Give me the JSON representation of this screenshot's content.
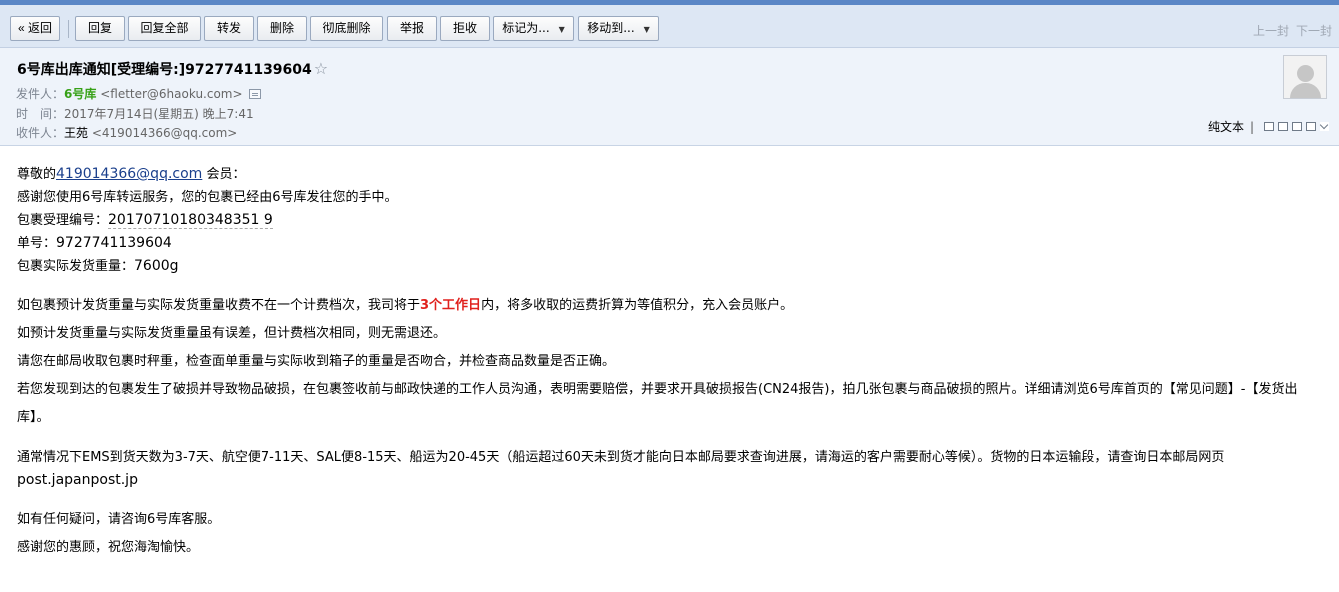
{
  "toolbar": {
    "back": "« 返回",
    "reply": "回复",
    "reply_all": "回复全部",
    "forward": "转发",
    "delete": "删除",
    "delete_forever": "彻底删除",
    "report": "举报",
    "reject": "拒收",
    "mark_as": "标记为...",
    "move_to": "移动到...",
    "prev": "上一封",
    "next": "下一封"
  },
  "header": {
    "subject": "6号库出库通知[受理编号:]9727741139604",
    "star": "☆",
    "from_label": "发件人：",
    "from_name": "6号库",
    "from_email": "<fletter@6haoku.com>",
    "time_label": "时　间：",
    "time_value": "2017年7月14日(星期五) 晚上7:41",
    "to_label": "收件人：",
    "to_name": "王苑",
    "to_email": "<419014366@qq.com>",
    "plain_text": "纯文本",
    "bar": "|"
  },
  "body": {
    "greet_prefix": "尊敬的",
    "greet_email": "419014366@qq.com",
    "greet_suffix": " 会员：",
    "line1": "感谢您使用6号库转运服务，您的包裹已经由6号库发往您的手中。",
    "accept_label": "包裹受理编号：",
    "accept_no": "20170710180348351 9",
    "order_label": "单号：",
    "order_no": "9727741139604",
    "weight_label": "包裹实际发货重量：",
    "weight_value": "7600g",
    "p1_a": "如包裹预计发货重量与实际发货重量收费不在一个计费档次，我司将于",
    "p1_hl": "3个工作日",
    "p1_b": "内，将多收取的运费折算为等值积分，充入会员账户。",
    "p2": "如预计发货重量与实际发货重量虽有误差，但计费档次相同，则无需退还。",
    "p3": "请您在邮局收取包裹时秤重，检查面单重量与实际收到箱子的重量是否吻合，并检查商品数量是否正确。",
    "p4": "若您发现到达的包裹发生了破损并导致物品破损，在包裹签收前与邮政快递的工作人员沟通，表明需要赔偿，并要求开具破损报告(CN24报告)，拍几张包裹与商品破损的照片。详细请浏览6号库首页的【常见问题】-【发货出库】。",
    "p5_a": "通常情况下EMS到货天数为3-7天、航空便7-11天、SAL便8-15天、船运为20-45天（船运超过60天未到货才能向日本邮局要求查询进展，请海运的客户需要耐心等候）。货物的日本运输段，请查询日本邮局网页 ",
    "p5_link": "post.japanpost.jp",
    "p6": "如有任何疑问，请咨询6号库客服。",
    "p7": "感谢您的惠顾，祝您海淘愉快。"
  }
}
